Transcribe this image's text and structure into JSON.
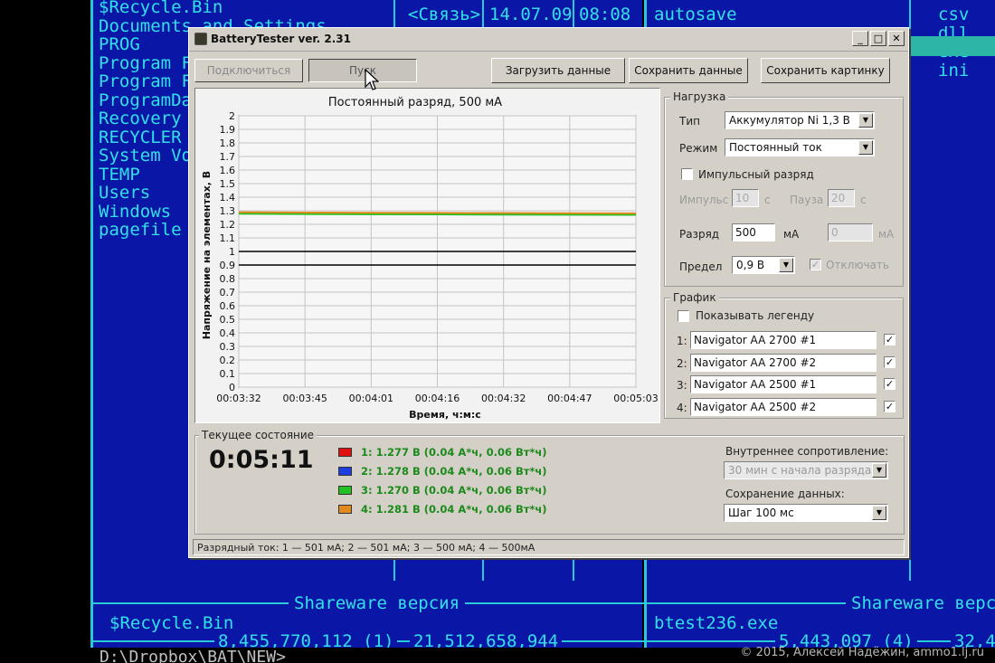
{
  "file_manager": {
    "left_entries": [
      "$Recycle.Bin",
      "Documents and Settings",
      "PROG",
      "Program F",
      "Program F",
      "ProgramDa",
      "Recovery",
      "RECYCLER",
      "System Vo",
      "TEMP",
      "Users",
      "Windows",
      "pagefile"
    ],
    "middle_entries": [
      "<Связь>"
    ],
    "middle_entries_2": [
      "14.07.09",
      "08:08"
    ],
    "right_entries": [
      "autosave"
    ],
    "ext_entries": [
      "csv",
      "dll",
      "exe",
      "ini"
    ],
    "left_footer_title": "Shareware версия",
    "right_footer_title": "Shareware версия",
    "left_current": "$Recycle.Bin",
    "right_current": "btest236.exe",
    "left_sizes": "8,455,770,112 (1)",
    "left_total": "21,512,658,944",
    "right_sizes": "5,443,097 (4)",
    "right_total": "32,4",
    "cmd_line": "D:\\Dropbox\\BAT\\NEW>"
  },
  "watermark": "© 2015, Алексей Надёжин, ammo1.lj.ru",
  "window": {
    "title": "BatteryTester ver. 2.31",
    "controls": {
      "minimize": "_",
      "maximize": "□",
      "close": "✕"
    },
    "buttons": {
      "connect": "Подключиться",
      "start": "Пуск",
      "load": "Загрузить данные",
      "save_data": "Сохранить данные",
      "save_image": "Сохранить картинку"
    },
    "load_group": {
      "label": "Нагрузка",
      "type_label": "Тип",
      "type_value": "Аккумулятор Ni 1,3 В",
      "mode_label": "Режим",
      "mode_value": "Постоянный ток",
      "pulse_label": "Импульсный разряд",
      "pulse_checked": false,
      "impulse_label": "Импульс",
      "impulse_value": "10",
      "impulse_unit": "с",
      "pause_label": "Пауза",
      "pause_value": "20",
      "pause_unit": "с",
      "discharge_label": "Разряд",
      "discharge_value": "500",
      "discharge_unit": "мА",
      "discharge2_value": "0",
      "discharge2_unit": "мА",
      "limit_label": "Предел",
      "limit_value": "0,9 В",
      "cutoff_label": "Отключать",
      "cutoff_checked": true
    },
    "graph_group": {
      "label": "График",
      "show_legend_label": "Показывать легенду",
      "show_legend_checked": false,
      "series": [
        {
          "index": "1:",
          "name": "Navigator AA 2700 #1",
          "checked": true
        },
        {
          "index": "2:",
          "name": "Navigator AA 2700 #2",
          "checked": true
        },
        {
          "index": "3:",
          "name": "Navigator AA 2500 #1",
          "checked": true
        },
        {
          "index": "4:",
          "name": "Navigator AA 2500 #2",
          "checked": true
        }
      ]
    },
    "current_state": {
      "label": "Текущее состояние",
      "elapsed": "0:05:11",
      "readings": [
        {
          "text": "1: 1.277 В (0.04 А*ч, 0.06 Вт*ч)",
          "color": "#e01010"
        },
        {
          "text": "2: 1.278 В (0.04 А*ч, 0.06 Вт*ч)",
          "color": "#1a3ee0"
        },
        {
          "text": "3: 1.270 В (0.04 А*ч, 0.06 Вт*ч)",
          "color": "#22c022"
        },
        {
          "text": "4: 1.281 В (0.04 А*ч, 0.06 Вт*ч)",
          "color": "#e08a20"
        }
      ],
      "internal_resistance_label": "Внутреннее сопротивление:",
      "internal_resistance_value": "30 мин с начала разряда",
      "data_saving_label": "Сохранение данных:",
      "data_saving_value": "Шаг 100 мс"
    },
    "status_bar": "Разрядный ток: 1 — 501 мА; 2 — 501 мА; 3 — 500 мА; 4 — 500мА"
  },
  "chart_data": {
    "type": "line",
    "title": "Постоянный разряд, 500 мА",
    "xlabel": "Время, ч:м:с",
    "ylabel": "Напряжение на элементах, В",
    "ylim": [
      0,
      2
    ],
    "yticks": [
      "0",
      "0.1",
      "0.2",
      "0.3",
      "0.4",
      "0.5",
      "0.6",
      "0.7",
      "0.8",
      "0.9",
      "1",
      "1.1",
      "1.2",
      "1.3",
      "1.4",
      "1.5",
      "1.6",
      "1.7",
      "1.8",
      "1.9",
      "2"
    ],
    "xticks": [
      "00:03:32",
      "00:03:45",
      "00:04:01",
      "00:04:16",
      "00:04:32",
      "00:04:47",
      "00:05:03"
    ],
    "grid": true,
    "reference_lines": [
      1.0,
      0.9
    ],
    "series": [
      {
        "name": "Navigator AA 2700 #1",
        "color": "#e01010",
        "values": [
          1.285,
          1.283,
          1.281,
          1.28,
          1.279,
          1.278,
          1.277
        ]
      },
      {
        "name": "Navigator AA 2700 #2",
        "color": "#1a3ee0",
        "values": [
          1.286,
          1.284,
          1.282,
          1.281,
          1.28,
          1.279,
          1.278
        ]
      },
      {
        "name": "Navigator AA 2500 #1",
        "color": "#22c022",
        "values": [
          1.278,
          1.276,
          1.274,
          1.273,
          1.272,
          1.271,
          1.27
        ]
      },
      {
        "name": "Navigator AA 2500 #2",
        "color": "#e08a20",
        "values": [
          1.289,
          1.287,
          1.285,
          1.284,
          1.283,
          1.282,
          1.281
        ]
      }
    ]
  }
}
